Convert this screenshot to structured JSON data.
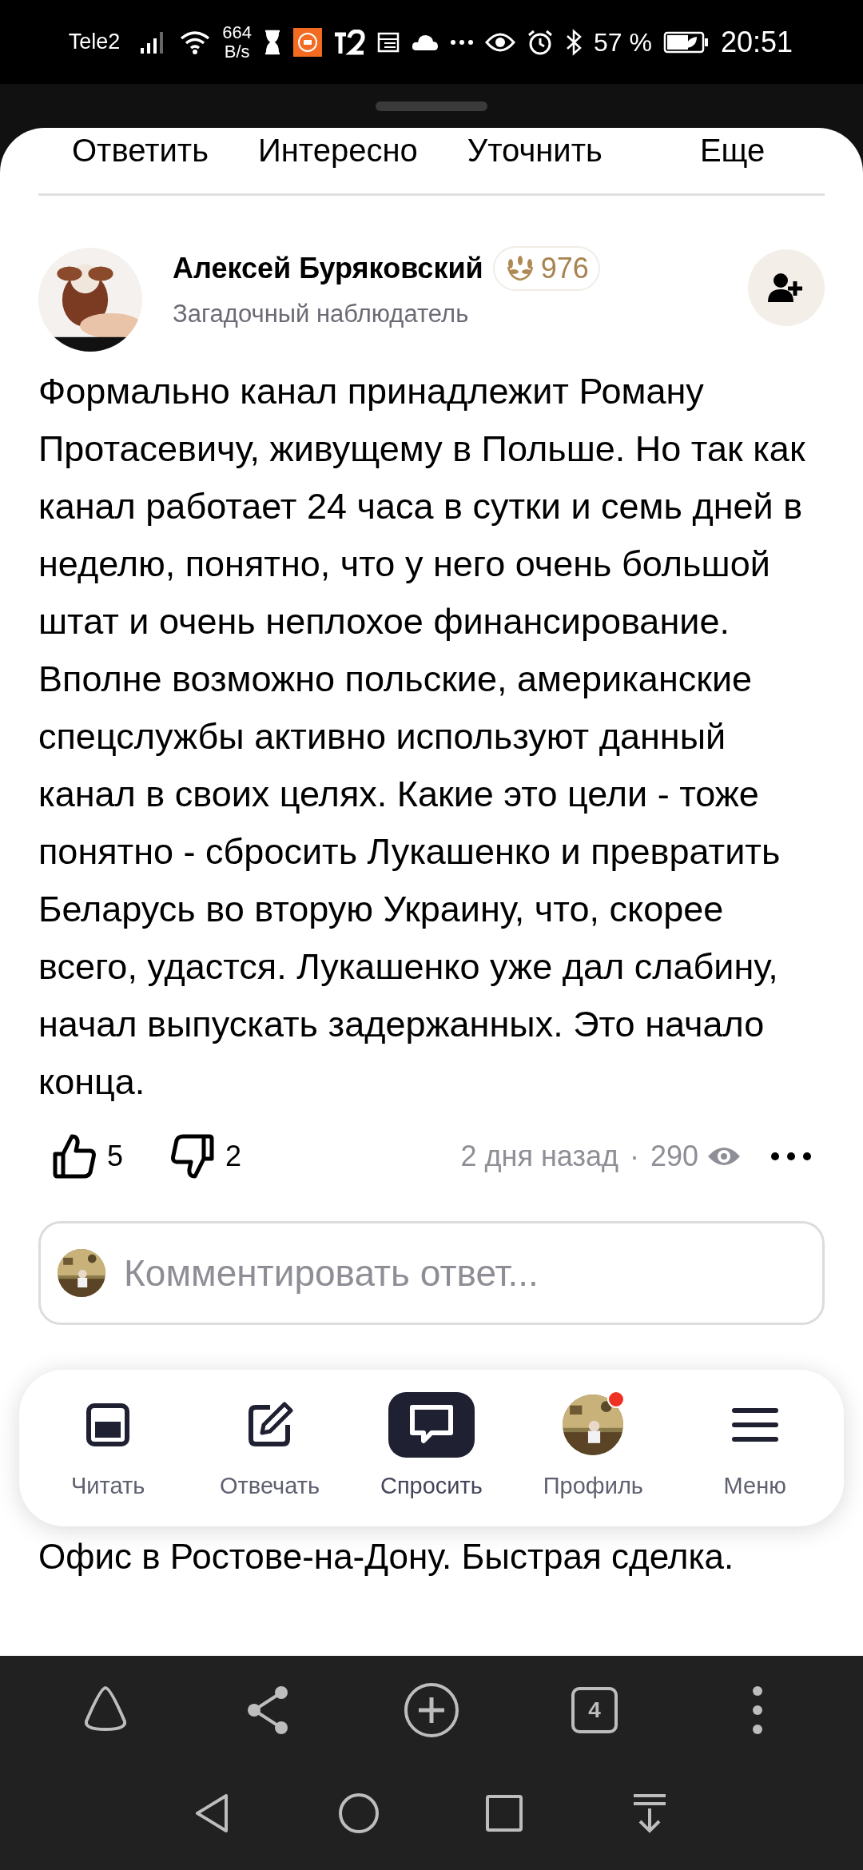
{
  "status_bar": {
    "carrier": "Tele2",
    "speed_value": "664",
    "speed_unit": "B/s",
    "battery": "57 %",
    "time": "20:51"
  },
  "top_actions": [
    "Ответить",
    "Интересно",
    "Уточнить",
    "Еще"
  ],
  "answer": {
    "author": "Алексей Буряковский",
    "score": "976",
    "subtitle": "Загадочный наблюдатель",
    "text": "Формально канал принадлежит Роману Протасевичу, живущему в Польше. Но так как канал работает 24 часа в сутки и семь дней в неделю, понятно, что у него очень большой штат и очень неплохое финансирование. Вполне возможно польские, американские спецслужбы активно используют данный канал в своих целях. Какие это цели - тоже понятно - сбросить Лукашенко и превратить Беларусь во вторую Украину, что, скорее всего, удастся. Лукашенко уже дал слабину, начал выпускать задержанных. Это начало конца.",
    "likes": "5",
    "dislikes": "2",
    "time": "2 дня назад",
    "separator": "·",
    "views": "290"
  },
  "comment_field": {
    "placeholder": "Комментировать ответ..."
  },
  "bottom_nav": [
    {
      "kind": "read",
      "label": "Читать",
      "selected": false
    },
    {
      "kind": "answer",
      "label": "Отвечать",
      "selected": false
    },
    {
      "kind": "ask",
      "label": "Спросить",
      "selected": true
    },
    {
      "kind": "profile",
      "label": "Профиль",
      "selected": false,
      "notification": true
    },
    {
      "kind": "menu",
      "label": "Меню",
      "selected": false
    }
  ],
  "ad_text": "Офис в Ростове-на-Дону. Быстрая сделка.",
  "browser_bar": {
    "tabs_count": "4"
  }
}
